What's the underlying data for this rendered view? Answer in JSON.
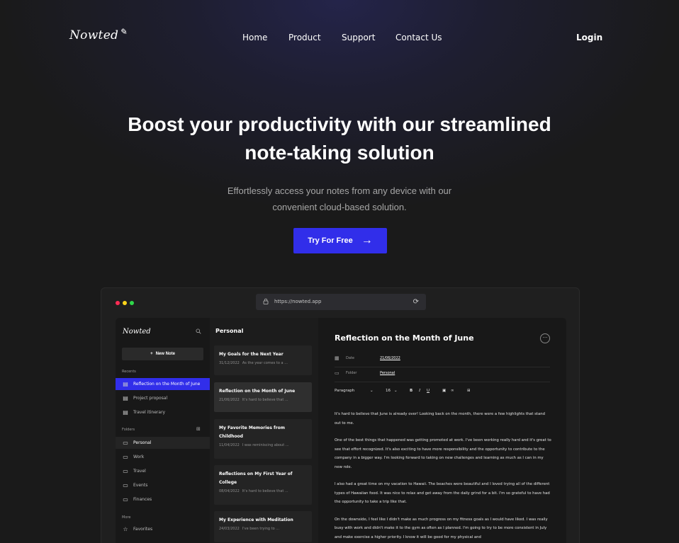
{
  "brand": {
    "name": "Nowted",
    "pen_icon": "pen-icon"
  },
  "nav": {
    "home": "Home",
    "product": "Product",
    "support": "Support",
    "contact": "Contact Us",
    "login": "Login"
  },
  "hero": {
    "title_regular": "Boost your productivity with our ",
    "title_bold_1": "streamlined",
    "title_bold_2": "note-taking solution",
    "subtitle_line1": "Effortlessly access your notes from any device with our",
    "subtitle_line2": "convenient cloud-based solution.",
    "cta_label": "Try For Free"
  },
  "browser": {
    "url": "https://nowted.app"
  },
  "app": {
    "logo": "Nowted",
    "new_note": "New Note",
    "recents_label": "Recents",
    "recents": [
      "Reflection on the Month of June",
      "Project proposal",
      "Travel itinerary"
    ],
    "folders_label": "Folders",
    "folders": [
      "Personal",
      "Work",
      "Travel",
      "Events",
      "Finances"
    ],
    "more_label": "More",
    "more_items": [
      "Favorites"
    ],
    "list_title": "Personal",
    "notes": [
      {
        "title": "My Goals for the Next Year",
        "date": "31/12/2022",
        "preview": "As the year comes to a ..."
      },
      {
        "title": "Reflection on the Month of June",
        "date": "21/06/2022",
        "preview": "It's hard to believe that ..."
      },
      {
        "title": "My Favorite Memories from Childhood",
        "date": "11/04/2022",
        "preview": "I was reminiscing about ..."
      },
      {
        "title": "Reflections on My First Year of College",
        "date": "08/04/2022",
        "preview": "It's hard to believe that ..."
      },
      {
        "title": "My Experience with Meditation",
        "date": "24/03/2022",
        "preview": "I've been trying to ..."
      }
    ],
    "editor": {
      "title": "Reflection on the Month of June",
      "date_label": "Date",
      "date_value": "21/06/2022",
      "folder_label": "Folder",
      "folder_value": "Personal",
      "paragraph_style": "Paragraph",
      "font_size": "16",
      "paragraphs": [
        "It's hard to believe that June is already over! Looking back on the month, there were a few highlights that stand out to me.",
        "One of the best things that happened was getting promoted at work. I've been working really hard and it's great to see that effort recognized. It's also exciting to have more responsibility and the opportunity to contribute to the company in a bigger way. I'm looking forward to taking on new challenges and learning as much as I can in my new role.",
        "I also had a great time on my vacation to Hawaii. The beaches were beautiful and I loved trying all of the different types of Hawaiian food. It was nice to relax and get away from the daily grind for a bit. I'm so grateful to have had the opportunity to take a trip like that.",
        "On the downside, I feel like I didn't make as much progress on my fitness goals as I would have liked. I was really busy with work and didn't make it to the gym as often as I planned. I'm going to try to be more consistent in July and make exercise a higher priority. I know it will be good for my physical and"
      ]
    }
  },
  "colors": {
    "accent": "#312eea",
    "background": "#1a1a1a"
  }
}
